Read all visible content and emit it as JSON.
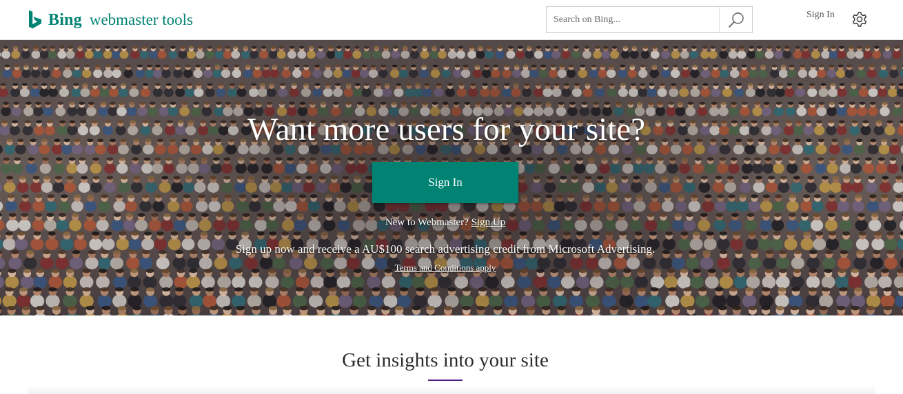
{
  "header": {
    "brand": "Bing",
    "product": "webmaster tools",
    "search_placeholder": "Search on Bing...",
    "sign_in_label": "Sign In",
    "icons": {
      "logo": "bing-logo-icon",
      "search": "search-icon",
      "settings": "gear-icon"
    },
    "brand_color": "#008373"
  },
  "hero": {
    "title": "Want more users for your site?",
    "sign_in_button": "Sign In",
    "new_prompt": "New to Webmaster?",
    "sign_up_link": "Sign Up",
    "promo": "Sign up now and receive a AU$100 search advertising credit from Microsoft Advertising.",
    "terms_link": "Terms and Conditions apply",
    "button_color": "#008373"
  },
  "insights": {
    "title": "Get insights into your site",
    "accent_color": "#4b1b83"
  }
}
